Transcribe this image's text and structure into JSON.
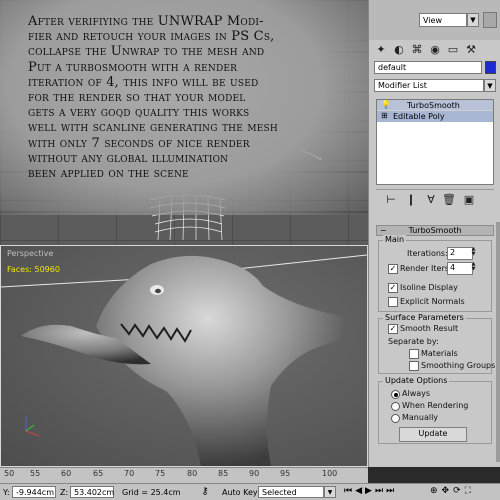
{
  "instruction": {
    "line1": "After verifiying the UNWRAP Modi-",
    "line2": "fier and retouch your images in PS Cs,",
    "line3": "collapse the Unwrap to the mesh and",
    "line4": "Put a turbosmooth  with a render",
    "line5": "iteration of 4, this info will be used",
    "line6": "for the render so that your model",
    "line7": "gets a very goqd quality this works",
    "line8": "well with scanline generating the mesh",
    "line9": "with only 7 seconds of nice render",
    "line10": "without  any global illumination",
    "line11": "been applied on the scene"
  },
  "viewport": {
    "label": "Perspective",
    "faces": "Faces: 50960"
  },
  "toolbar": {
    "view_dropdown": "View"
  },
  "command_panel": {
    "object_name": "default",
    "object_color": "#1a2bd1",
    "modifier_list": "Modifier List",
    "stack": [
      "TurboSmooth",
      "Editable Poly"
    ]
  },
  "turbosmooth": {
    "title": "TurboSmooth",
    "main_group": "Main",
    "iterations_label": "Iterations:",
    "iterations_value": "2",
    "render_iters_label": "Render Iters:",
    "render_iters_value": "4",
    "render_iters_checked": true,
    "isoline_label": "Isoline Display",
    "isoline_checked": true,
    "explicit_normals_label": "Explicit Normals",
    "explicit_normals_checked": false,
    "surface_group": "Surface Parameters",
    "smooth_result_label": "Smooth Result",
    "smooth_result_checked": true,
    "separate_by_label": "Separate by:",
    "materials_label": "Materials",
    "smoothing_groups_label": "Smoothing Groups",
    "update_group": "Update Options",
    "always_label": "Always",
    "when_rendering_label": "When Rendering",
    "manually_label": "Manually",
    "update_mode": "Always",
    "update_button": "Update"
  },
  "timeline": {
    "ticks": [
      "50",
      "55",
      "60",
      "65",
      "70",
      "75",
      "80",
      "85",
      "90",
      "95",
      "100"
    ]
  },
  "status": {
    "y_value": "-9.944cm",
    "z_label": "Z:",
    "z_value": "53.402cm",
    "grid": "Grid = 25.4cm",
    "auto_key": "Auto Key",
    "selected": "Selected",
    "y_label": "Y:"
  }
}
